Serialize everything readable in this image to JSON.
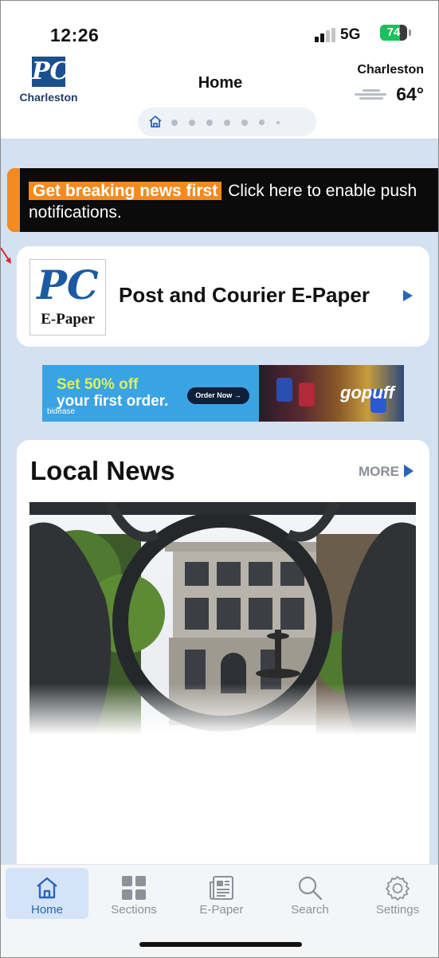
{
  "status_bar": {
    "time": "12:26",
    "network": "5G",
    "battery": "74",
    "battery_level": 0.74
  },
  "header": {
    "logo_text": "PC",
    "logo_city": "Charleston",
    "title": "Home",
    "weather_city": "Charleston",
    "weather_temp": "64°",
    "weather_icon": "cloud-icon",
    "page_indicator_count": 8,
    "page_indicator_active": 0
  },
  "push_banner": {
    "badge": "Get breaking news first",
    "text": "Click here to enable push notifications.",
    "accent_color": "#f58a1f"
  },
  "epaper": {
    "logo_text": "PC",
    "logo_sub": "E-Paper",
    "title": "Post and Courier E-Paper"
  },
  "ad": {
    "headline_1": "Set 50% off",
    "headline_2": "your first order.",
    "button": "Order Now →",
    "brand": "bidease",
    "partner": "gopuff"
  },
  "local_news": {
    "title": "Local News",
    "more_label": "MORE"
  },
  "tab_bar": {
    "active_color": "#2a66b4",
    "items": [
      {
        "label": "Home",
        "icon": "home-icon"
      },
      {
        "label": "Sections",
        "icon": "grid-icon"
      },
      {
        "label": "E-Paper",
        "icon": "newspaper-icon"
      },
      {
        "label": "Search",
        "icon": "search-icon"
      },
      {
        "label": "Settings",
        "icon": "gear-icon"
      }
    ]
  }
}
